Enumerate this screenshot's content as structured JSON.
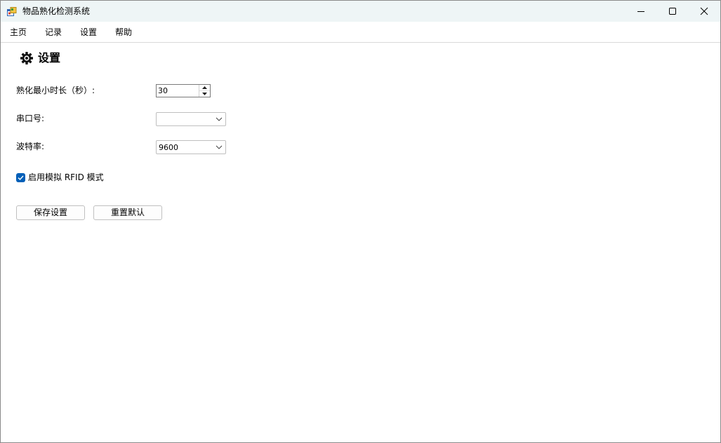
{
  "window": {
    "title": "物品熟化检测系统",
    "icon": "app-form-icon",
    "controls": [
      "minimize-icon",
      "maximize-icon",
      "close-icon"
    ]
  },
  "menu": {
    "items": [
      "主页",
      "记录",
      "设置",
      "帮助"
    ]
  },
  "settings": {
    "title": "设置",
    "title_icon": "gear-icon",
    "min_duration": {
      "label": "熟化最小时长（秒）:",
      "value": "30"
    },
    "serial_port": {
      "label": "串口号:",
      "value": ""
    },
    "baud_rate": {
      "label": "波特率:",
      "value": "9600"
    },
    "simulate_rfid": {
      "label": "启用模拟 RFID 模式",
      "checked": true
    },
    "save_label": "保存设置",
    "reset_label": "重置默认"
  },
  "colors": {
    "titlebar_bg": "#eef5f6",
    "accent": "#005fb8"
  }
}
